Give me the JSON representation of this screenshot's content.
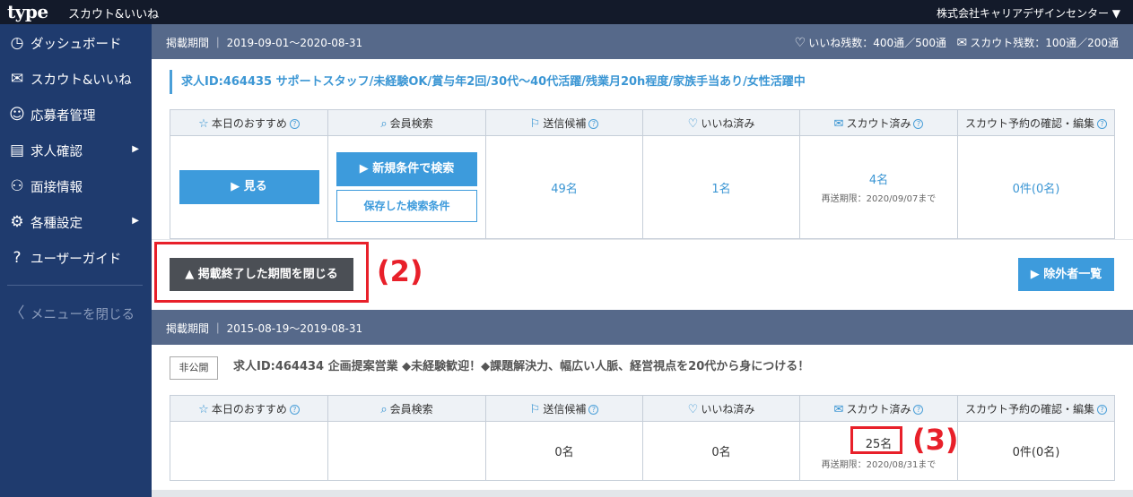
{
  "topbar": {
    "logo": "type",
    "service_name": "スカウト&いいね",
    "company": "株式会社キャリアデザインセンター ▼"
  },
  "sidebar": {
    "items": [
      {
        "icon": "dashboard-icon",
        "glyph": "◷",
        "label": "ダッシュボード",
        "has_arrow": false
      },
      {
        "icon": "mail-icon",
        "glyph": "✉",
        "label": "スカウト&いいね",
        "has_arrow": false
      },
      {
        "icon": "person-icon",
        "glyph": "☺",
        "label": "応募者管理",
        "has_arrow": false
      },
      {
        "icon": "job-listing-icon",
        "glyph": "▤",
        "label": "求人確認",
        "has_arrow": true
      },
      {
        "icon": "people-icon",
        "glyph": "⚇",
        "label": "面接情報",
        "has_arrow": false
      },
      {
        "icon": "gear-icon",
        "glyph": "⚙",
        "label": "各種設定",
        "has_arrow": true
      },
      {
        "icon": "help-icon",
        "glyph": "?",
        "label": "ユーザーガイド",
        "has_arrow": false
      }
    ],
    "arrow_glyph": "▶",
    "close_menu": {
      "glyph": "〈",
      "label": "メニューを閉じる"
    }
  },
  "period1": {
    "label": "掲載期間 ｜ 2019-09-01〜2020-08-31",
    "like_remaining": "いいね残数：400通／500通",
    "scout_remaining": "スカウト残数：100通／200通"
  },
  "job1": {
    "title": "求人ID:464435 サポートスタッフ/未経験OK/賞与年2回/30代〜40代活躍/残業月20h程度/家族手当あり/女性活躍中"
  },
  "columns": [
    {
      "icon": "star-icon",
      "glyph": "☆",
      "label": "本日のおすすめ",
      "help": true
    },
    {
      "icon": "search-icon",
      "glyph": "⌕",
      "label": "会員検索",
      "help": false
    },
    {
      "icon": "bookmark-icon",
      "glyph": "⚐",
      "label": "送信候補",
      "help": true
    },
    {
      "icon": "heart-icon",
      "glyph": "♡",
      "label": "いいね済み",
      "help": false
    },
    {
      "icon": "mail-icon",
      "glyph": "✉",
      "label": "スカウト済み",
      "help": true
    },
    {
      "icon": "",
      "glyph": "",
      "label": "スカウト予約の確認・編集",
      "help": true
    }
  ],
  "row1": {
    "view_button": "▶ 見る",
    "new_search_button": "▶ 新規条件で検索",
    "saved_search_button": "保存した検索条件",
    "send_candidates": "49名",
    "liked": "1名",
    "scouted": "4名",
    "resend_deadline": "再送期限：2020/09/07まで",
    "reservations": "0件(0名)"
  },
  "actions": {
    "close_periods_button": "▲ 掲載終了した期間を閉じる",
    "excluded_list_button": "▶ 除外者一覧"
  },
  "period2": {
    "label": "掲載期間 ｜ 2015-08-19〜2019-08-31"
  },
  "job2": {
    "status_badge": "非公開",
    "title": "求人ID:464434 企画提案営業 ◆未経験歓迎！◆課題解決力、幅広い人脈、経営視点を20代から身につける！"
  },
  "row2": {
    "send_candidates": "0名",
    "liked": "0名",
    "scouted": "25名",
    "resend_deadline": "再送期限：2020/08/31まで",
    "reservations": "0件(0名)"
  },
  "annotations": {
    "label2": "(2)",
    "label3": "(3)",
    "color": "#e8202a"
  },
  "help_glyph": "?",
  "heart_glyph": "♡",
  "mail_glyph": "✉"
}
